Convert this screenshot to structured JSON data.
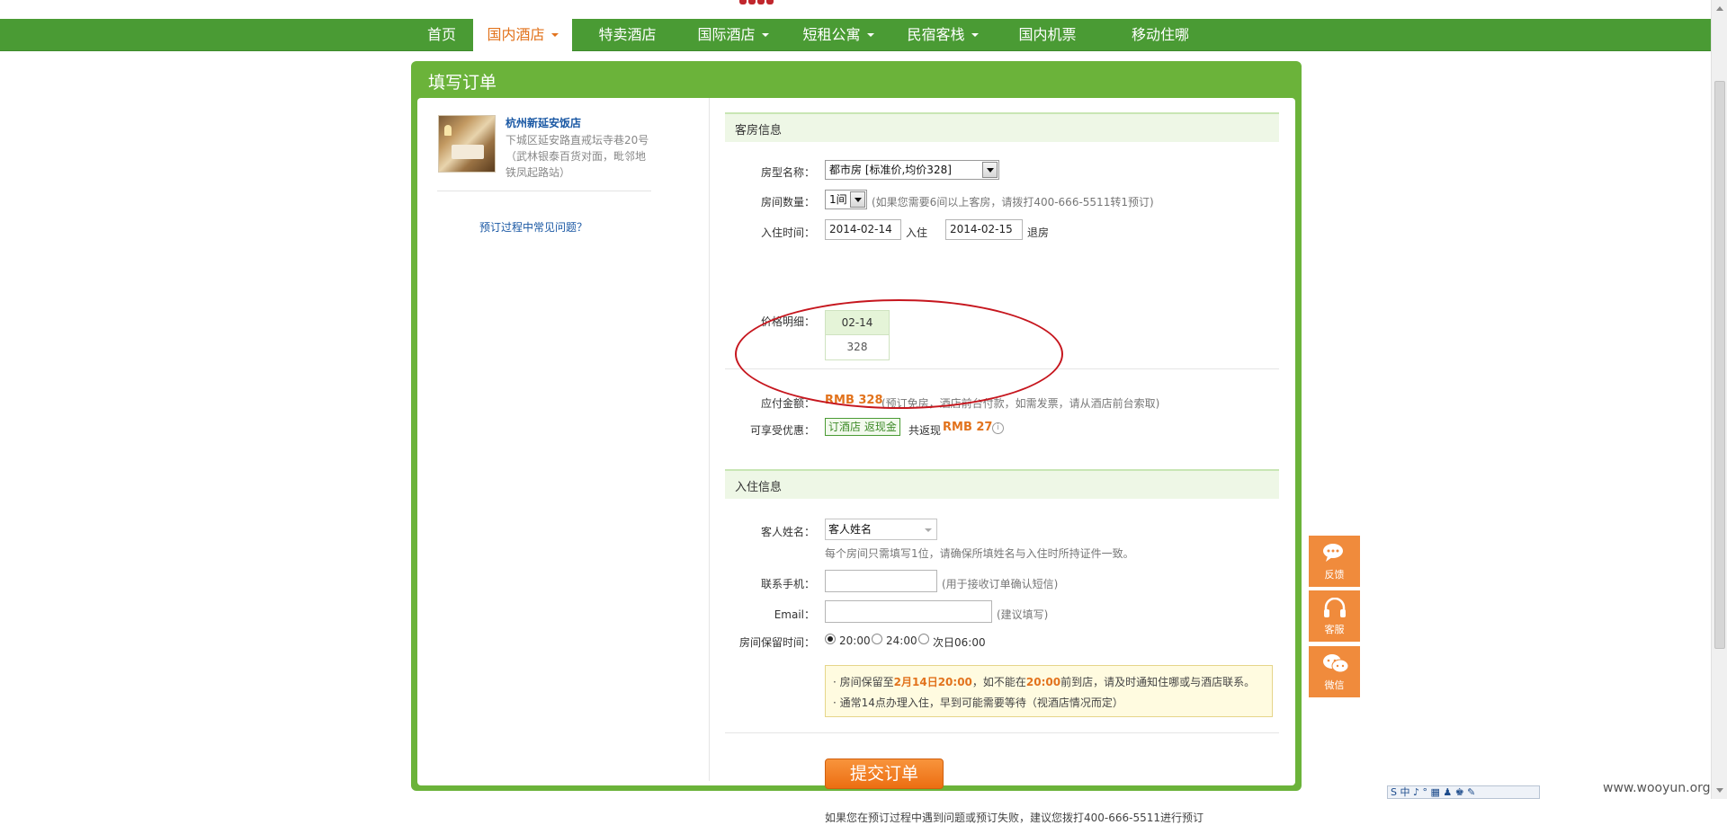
{
  "nav": {
    "items": [
      {
        "label": "首页",
        "caret": false
      },
      {
        "label": "国内酒店",
        "caret": true,
        "active": true
      },
      {
        "label": "特卖酒店",
        "caret": false
      },
      {
        "label": "国际酒店",
        "caret": true
      },
      {
        "label": "短租公寓",
        "caret": true
      },
      {
        "label": "民宿客栈",
        "caret": true
      },
      {
        "label": "国内机票",
        "caret": false
      },
      {
        "label": "移动住哪",
        "caret": false
      }
    ]
  },
  "card": {
    "title": "填写订单"
  },
  "hotel": {
    "name": "杭州新延安饭店",
    "address": "下城区延安路直戒坛寺巷20号（武林银泰百货对面，毗邻地铁凤起路站）",
    "faq_link": "预订过程中常见问题？"
  },
  "room_section": {
    "title": "客房信息",
    "room_type_label": "房型名称：",
    "room_type_value": "都市房 [标准价,均价328]",
    "room_count_label": "房间数量：",
    "room_count_value": "1间",
    "room_count_hint": "(如果您需要6间以上客房，请拨打400-666-5511转1预订)",
    "checkin_label": "入住时间：",
    "checkin_date": "2014-02-14",
    "checkin_suffix": "入住",
    "checkout_date": "2014-02-15",
    "checkout_suffix": "退房",
    "price_detail_label": "价格明细：",
    "price_detail_date": "02-14",
    "price_detail_value": "328"
  },
  "payment": {
    "amount_label": "应付金额：",
    "amount_value": "RMB 328",
    "amount_hint": "(预订免房，酒店前台付款，如需发票，请从酒店前台索取)",
    "discount_label": "可享受优惠：",
    "promo_tag": "订酒店 返现金",
    "cashback_prefix": "共返现",
    "cashback_value": "RMB 27",
    "info_icon": "i"
  },
  "guest_section": {
    "title": "入住信息",
    "name_label": "客人姓名：",
    "name_value": "客人姓名",
    "name_hint": "每个房间只需填写1位，请确保所填姓名与入住时所持证件一致。",
    "phone_label": "联系手机：",
    "phone_value": "",
    "phone_hint": "(用于接收订单确认短信)",
    "email_label": "Email：",
    "email_value": "",
    "email_hint": "(建议填写)",
    "hold_label": "房间保留时间：",
    "hold_options": [
      "20:00",
      "24:00",
      "次日06:00"
    ]
  },
  "notice": {
    "line1_a": "· 房间保留至",
    "line1_b": "2月14日20:00",
    "line1_c": "，如不能在",
    "line1_d": "20:00",
    "line1_e": "前到店，请及时通知住哪或与酒店联系。",
    "line2": "· 通常14点办理入住，早到可能需要等待（视酒店情况而定）"
  },
  "submit": {
    "label": "提交订单"
  },
  "footer_note": "如果您在预订过程中遇到问题或预订失败，建议您拨打400-666-5511进行预订",
  "float_buttons": [
    {
      "label": "反馈",
      "icon": "chat-bubble-icon"
    },
    {
      "label": "客服",
      "icon": "headset-icon"
    },
    {
      "label": "微信",
      "icon": "wechat-icon"
    }
  ],
  "ime_bar": "S 中 ♪ ° ▦ ♟ ♚ ✎",
  "watermark": "www.wooyun.org",
  "colors": {
    "nav_green": "#4a9b34",
    "accent_orange": "#e2731d",
    "link_blue": "#1a58a4",
    "annotation_red": "#c6161e"
  }
}
